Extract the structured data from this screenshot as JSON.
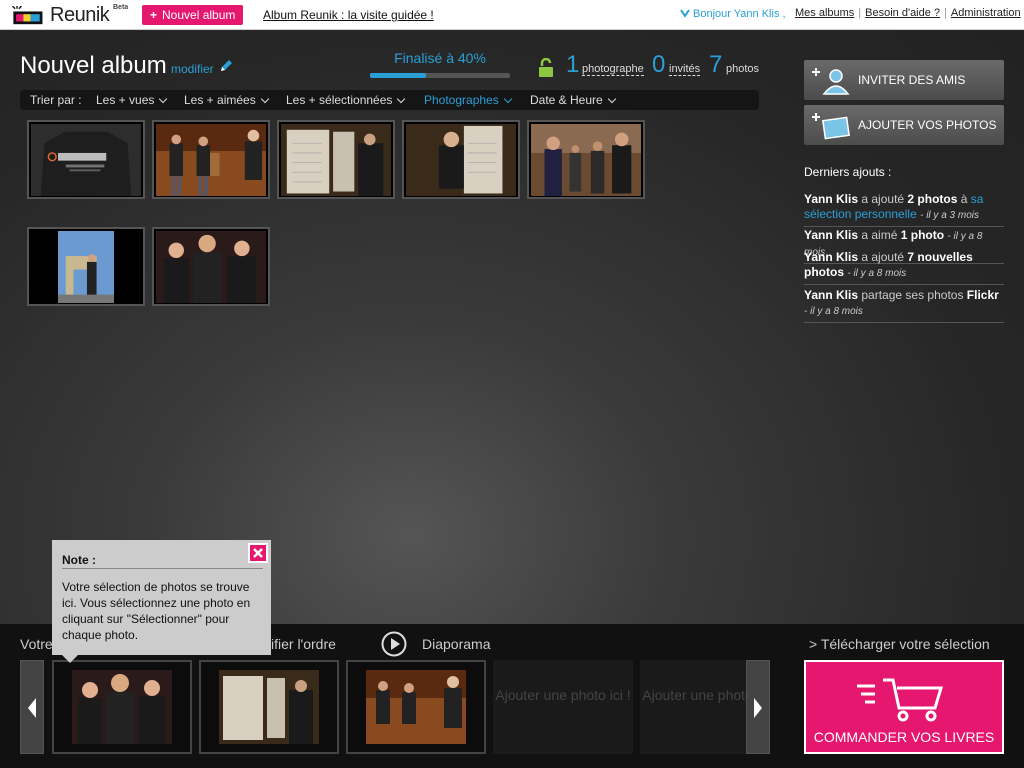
{
  "topbar": {
    "logo_text": "Reunik",
    "logo_badge": "Beta",
    "new_album": "Nouvel album",
    "tour_link": "Album Reunik : la visite guidée !",
    "greeting": "Bonjour Yann Klis ,",
    "links": [
      "Mes albums",
      "Besoin d'aide ?",
      "Administration"
    ],
    "separator": "|"
  },
  "album": {
    "title": "Nouvel album",
    "edit_link": "modifier",
    "progress_label": "Finalisé à 40%",
    "progress_pct": 40,
    "stats": [
      {
        "num": "1",
        "label": "photographe"
      },
      {
        "num": "0",
        "label": "invités"
      },
      {
        "num": "7",
        "label": "photos"
      }
    ]
  },
  "sortbar": {
    "label": "Trier par :",
    "options": [
      "Les + vues",
      "Les + aimées",
      "Les + sélectionnées",
      "Photographes",
      "Date & Heure"
    ],
    "active": "Photographes"
  },
  "photos": [
    {
      "desc": "railscamp t-shirt"
    },
    {
      "desc": "two people in room"
    },
    {
      "desc": "whiteboard and person"
    },
    {
      "desc": "person near whiteboard"
    },
    {
      "desc": "group in hall"
    },
    {
      "desc": "arc de triomphe"
    },
    {
      "desc": "three people posing"
    }
  ],
  "actions": {
    "invite": "INVITER DES AMIS",
    "add_photos": "AJOUTER VOS PHOTOS"
  },
  "recent": {
    "title": "Derniers ajouts :",
    "items": [
      {
        "user": "Yann Klis",
        "verb": "a ajouté",
        "what": "2 photos",
        "prep": "à",
        "link": "sa sélection personnelle",
        "when": "- il y a 3 mois"
      },
      {
        "user": "Yann Klis",
        "verb": "a aimé",
        "what": "1 photo",
        "when": "- il y a 8 mois"
      },
      {
        "user": "Yann Klis",
        "verb": "a ajouté",
        "what": "7 nouvelles photos",
        "when": "- il y a 8 mois"
      },
      {
        "user": "Yann Klis",
        "verb": "partage ses photos",
        "what": "Flickr",
        "when": "- il y a 8 mois"
      }
    ]
  },
  "bottom": {
    "selection_label": "Votre",
    "order_label": "ifier l'ordre",
    "slideshow": "Diaporama",
    "download": "> Télécharger votre sélection",
    "empty_slot": "Ajouter une photo ici !",
    "order_button": "COMMANDER VOS LIVRES"
  },
  "note": {
    "title": "Note :",
    "body": "Votre sélection de photos se trouve ici. Vous sélectionnez une photo en cliquant sur \"Sélectionner\" pour chaque photo."
  },
  "colors": {
    "accent": "#e5176f",
    "link": "#2a9fd6"
  }
}
